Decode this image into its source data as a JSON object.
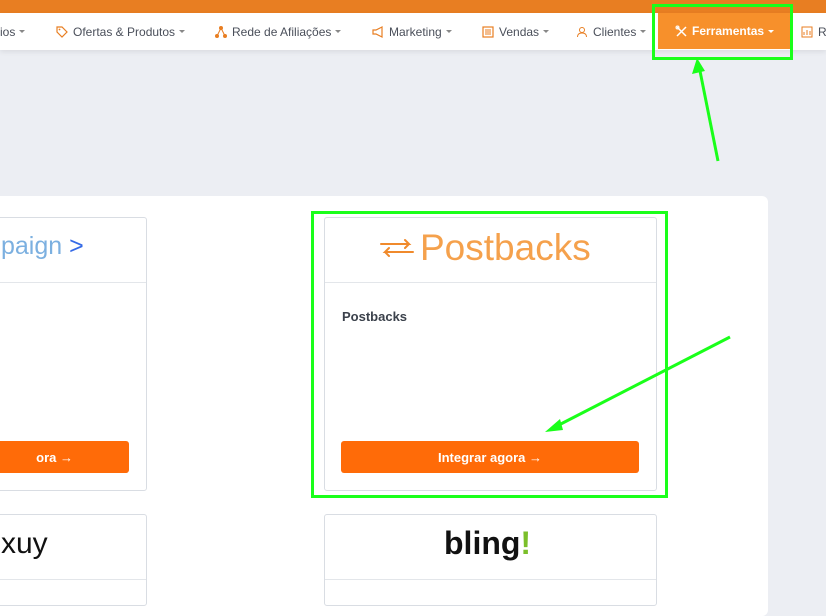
{
  "nav": {
    "items": [
      {
        "label": "ios",
        "icon": "none"
      },
      {
        "label": "Ofertas & Produtos",
        "icon": "tag-icon"
      },
      {
        "label": "Rede de Afiliações",
        "icon": "network-icon"
      },
      {
        "label": "Marketing",
        "icon": "megaphone-icon"
      },
      {
        "label": "Vendas",
        "icon": "list-icon"
      },
      {
        "label": "Clientes",
        "icon": "user-icon"
      },
      {
        "label": "Ferramentas",
        "icon": "tools-icon"
      },
      {
        "label": "Re",
        "icon": "chart-icon"
      }
    ]
  },
  "cards": {
    "activecampaign": {
      "logo_text": "paign",
      "button": "ora →"
    },
    "postbacks": {
      "logo_text": "Postbacks",
      "title": "Postbacks",
      "button": "Integrar agora →"
    },
    "kuy": {
      "logo_text": "xuy"
    },
    "bling": {
      "logo_text": "bling"
    }
  },
  "colors": {
    "accent": "#f7902b",
    "button": "#ff6b08",
    "highlight": "#1aff1a",
    "topbar": "#e87e22"
  }
}
